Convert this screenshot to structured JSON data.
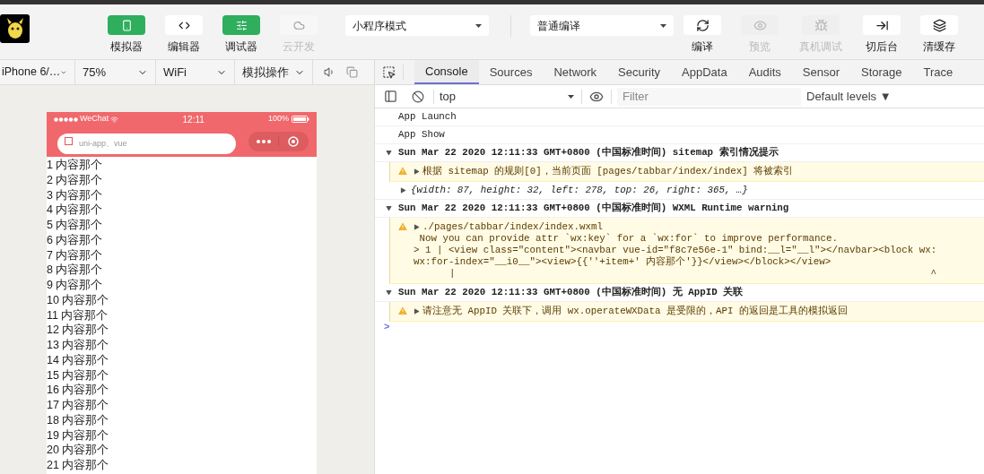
{
  "toolbar": {
    "buttons": [
      {
        "label": "模拟器",
        "selected": true,
        "disabled": false
      },
      {
        "label": "编辑器",
        "selected": false,
        "disabled": false
      },
      {
        "label": "调试器",
        "selected": true,
        "disabled": false
      },
      {
        "label": "云开发",
        "selected": false,
        "disabled": true
      }
    ],
    "mode_select": "小程序模式",
    "compile_select": "普通编译",
    "actions": [
      {
        "label": "编译",
        "disabled": false
      },
      {
        "label": "预览",
        "disabled": true
      },
      {
        "label": "真机调试",
        "disabled": true
      },
      {
        "label": "切后台",
        "disabled": false
      },
      {
        "label": "清缓存",
        "disabled": false
      }
    ]
  },
  "simulator": {
    "device": "iPhone 6/…",
    "zoom": "75%",
    "network": "WiFi",
    "operation": "模拟操作",
    "status_bar": {
      "carrier": "WeChat",
      "time": "12:11",
      "battery": "100%"
    },
    "search": {
      "placeholder": "uni-app、vue"
    },
    "items": [
      "1 内容那个",
      "2 内容那个",
      "3 内容那个",
      "4 内容那个",
      "5 内容那个",
      "6 内容那个",
      "7 内容那个",
      "8 内容那个",
      "9 内容那个",
      "10 内容那个",
      "11 内容那个",
      "12 内容那个",
      "13 内容那个",
      "14 内容那个",
      "15 内容那个",
      "16 内容那个",
      "17 内容那个",
      "18 内容那个",
      "19 内容那个",
      "20 内容那个",
      "21 内容那个"
    ]
  },
  "devtools": {
    "tabs": [
      {
        "label": "Console",
        "selected": true
      },
      {
        "label": "Sources",
        "selected": false
      },
      {
        "label": "Network",
        "selected": false
      },
      {
        "label": "Security",
        "selected": false
      },
      {
        "label": "AppData",
        "selected": false
      },
      {
        "label": "Audits",
        "selected": false
      },
      {
        "label": "Sensor",
        "selected": false
      },
      {
        "label": "Storage",
        "selected": false
      },
      {
        "label": "Trace",
        "selected": false
      }
    ],
    "context": "top",
    "filter": {
      "placeholder": "Filter"
    },
    "levels": "Default levels ▼",
    "logs": [
      {
        "kind": "plain",
        "text": "App Launch"
      },
      {
        "kind": "plain",
        "text": "App Show"
      },
      {
        "kind": "group",
        "expanded": true,
        "text": "Sun Mar 22 2020 12:11:33 GMT+0800 (中国标准时间) sitemap 索引情况提示"
      },
      {
        "kind": "warning",
        "expanded": false,
        "lines": [
          "根据 sitemap 的规则[0]，当前页面 [pages/tabbar/index/index] 将被索引"
        ]
      },
      {
        "kind": "object",
        "expanded": false,
        "text": "{width: 87, height: 32, left: 278, top: 26, right: 365, …}"
      },
      {
        "kind": "group",
        "expanded": true,
        "text": "Sun Mar 22 2020 12:11:33 GMT+0800 (中国标准时间) WXML Runtime warning"
      },
      {
        "kind": "warning",
        "expanded": false,
        "lines": [
          "./pages/tabbar/index/index.wxml",
          " Now you can provide attr `wx:key` for a `wx:for` to improve performance.",
          "> 1 | <view class=\"content\"><navbar vue-id=\"f8c7e56e-1\" bind:__l=\"__l\"></navbar><block wx:",
          "wx:for-index=\"__i0__\"><view>{{''+item+' 内容那个'}}</view></block></view>"
        ],
        "markers": [
          "|",
          "^"
        ]
      },
      {
        "kind": "group",
        "expanded": true,
        "text": "Sun Mar 22 2020 12:11:33 GMT+0800 (中国标准时间) 无 AppID 关联"
      },
      {
        "kind": "warning",
        "expanded": false,
        "lines": [
          "请注意无 AppID 关联下，调用 wx.operateWXData 是受限的，API 的返回是工具的模拟返回"
        ]
      }
    ],
    "prompt": ">"
  }
}
